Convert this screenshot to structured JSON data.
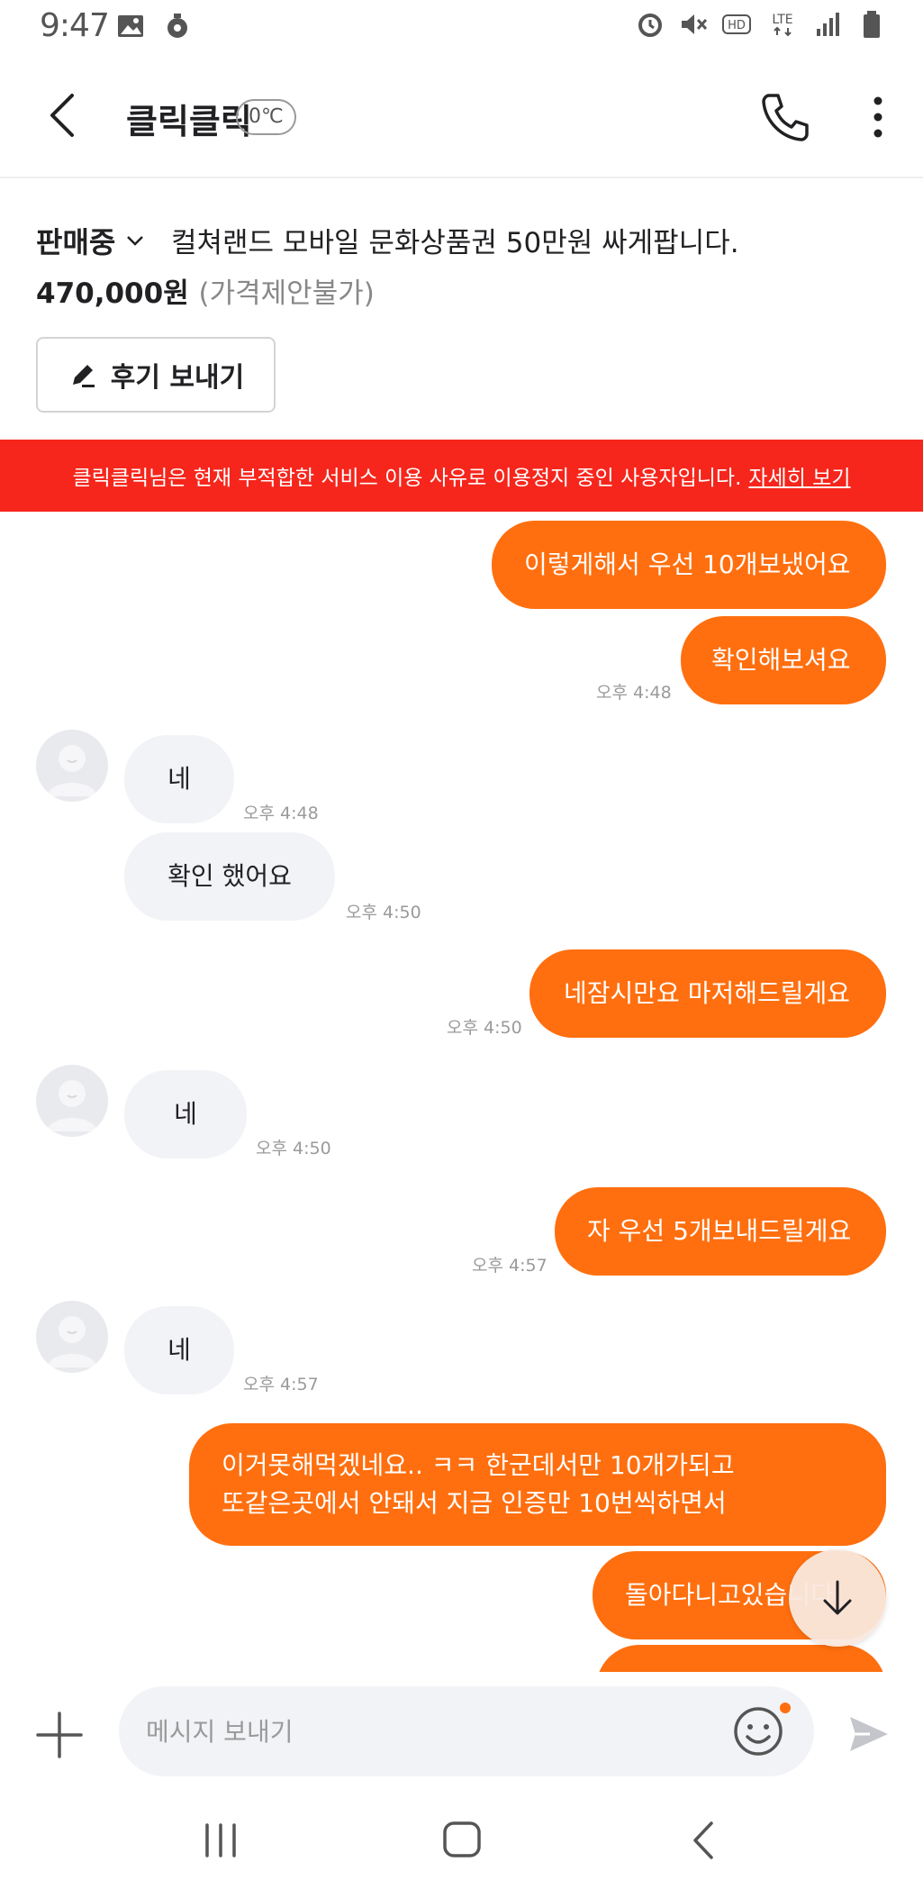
{
  "status_bar": {
    "time": "9:47",
    "icons": [
      "image-icon",
      "lens-icon",
      "alarm-icon",
      "mute-icon",
      "hd-icon",
      "lte-icon",
      "signal-icon",
      "battery-icon"
    ],
    "hd_label": "HD",
    "lte_label": "LTE"
  },
  "header": {
    "title": "클릭클릭",
    "temperature": "0℃"
  },
  "product": {
    "status": "판매중",
    "title": "컬쳐랜드 모바일 문화상품권 50만원 싸게팝니다.",
    "price": "470,000원",
    "price_note": "(가격제안불가)",
    "review_button": "후기 보내기"
  },
  "banner": {
    "text": "클릭클릭님은 현재 부적합한 서비스 이용 사유로 이용정지 중인 사용자입니다.",
    "link": "자세히 보기"
  },
  "messages": [
    {
      "direction": "out",
      "lines": [
        "이렇게해서 우선 10개보냈어요"
      ],
      "time": ""
    },
    {
      "direction": "out",
      "lines": [
        "확인해보셔요"
      ],
      "time": "오후 4:48"
    },
    {
      "direction": "in",
      "lines": [
        "네"
      ],
      "time": "오후 4:48"
    },
    {
      "direction": "in",
      "lines": [
        "확인 했어요"
      ],
      "time": "오후 4:50"
    },
    {
      "direction": "out",
      "lines": [
        "네잠시만요 마저해드릴게요"
      ],
      "time": "오후 4:50"
    },
    {
      "direction": "in",
      "lines": [
        "네"
      ],
      "time": "오후 4:50"
    },
    {
      "direction": "out",
      "lines": [
        "자 우선 5개보내드릴게요"
      ],
      "time": "오후 4:57"
    },
    {
      "direction": "in",
      "lines": [
        "네"
      ],
      "time": "오후 4:57"
    },
    {
      "direction": "out",
      "lines": [
        "이거못해먹겠네요.. ㅋㅋ 한군데서만 10개가되고",
        "또같은곳에서 안돼서 지금 인증만 10번씩하면서"
      ],
      "time": ""
    },
    {
      "direction": "out",
      "lines": [
        "돌아다니고있습니다"
      ],
      "time": ""
    }
  ],
  "input": {
    "placeholder": "메시지 보내기"
  },
  "colors": {
    "brand_orange": "#ff6f0f",
    "banner_red": "#f6261c",
    "incoming_bubble": "#f2f3f6"
  }
}
